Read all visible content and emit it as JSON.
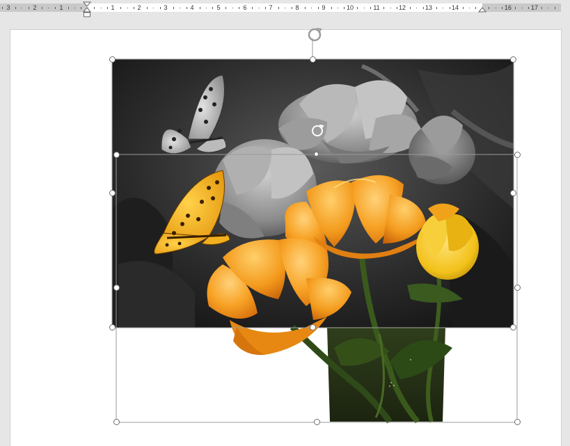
{
  "ruler": {
    "numbers": [
      "3",
      "2",
      "1",
      "1",
      "2",
      "3",
      "4",
      "5",
      "6",
      "7",
      "8",
      "9",
      "10",
      "11",
      "12",
      "13",
      "14",
      "16",
      "17"
    ]
  },
  "image": {
    "description_icon": "rotate-icon"
  },
  "colors": {
    "page": "#ffffff",
    "workspace": "#e6e6e6",
    "selection": "#9a9a9a",
    "flower_orange": "#f39a1c",
    "flower_yellow": "#f2c11a"
  }
}
